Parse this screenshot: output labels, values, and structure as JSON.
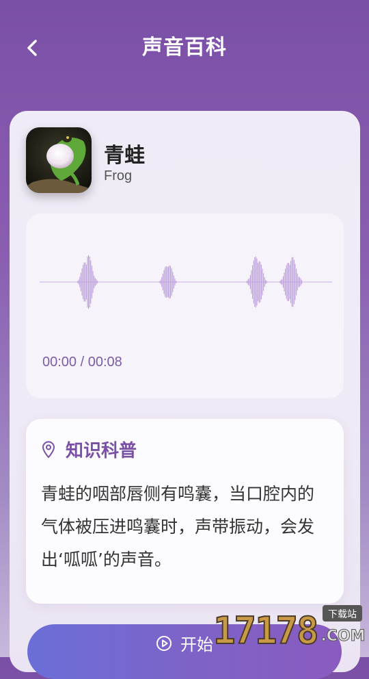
{
  "header": {
    "title": "声音百科",
    "back_icon": "chevron-left-icon"
  },
  "animal": {
    "name": "青蛙",
    "english_name": "Frog"
  },
  "player": {
    "current_time": "00:00",
    "separator": " / ",
    "total_time": "00:08",
    "progress": 0
  },
  "knowledge": {
    "icon": "location-pin-icon",
    "title": "知识科普",
    "text": "青蛙的咽部唇侧有鸣囊，当口腔内的气体被压进鸣囊时，声带振动，会发出‘呱呱’的声音。"
  },
  "start_button": {
    "label": "开始",
    "icon": "play-circle-icon"
  },
  "watermark": {
    "number": "17178",
    "text_top": "下载站",
    "text_bottom": ".COM"
  },
  "colors": {
    "accent": "#7a4fa6",
    "waveform": "#b89ad8",
    "button_start": "#6a6fd8",
    "button_end": "#8a5bbf"
  }
}
